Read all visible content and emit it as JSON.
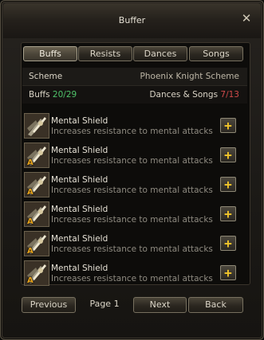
{
  "window": {
    "title": "Buffer",
    "close_icon": "close-icon"
  },
  "tabs": [
    {
      "label": "Buffs",
      "active": true
    },
    {
      "label": "Resists",
      "active": false
    },
    {
      "label": "Dances",
      "active": false
    },
    {
      "label": "Songs",
      "active": false
    }
  ],
  "scheme": {
    "label": "Scheme",
    "value": "Phoenix Knight Scheme"
  },
  "counts": {
    "buffs_label": "Buffs",
    "buffs_value": "20/29",
    "dances_label": "Dances & Songs",
    "dances_value": "7/13"
  },
  "buffs": [
    {
      "name": "Mental Shield",
      "desc": "Increases resistance to mental attacks",
      "badge": ""
    },
    {
      "name": "Mental Shield",
      "desc": "Increases resistance to mental attacks",
      "badge": "A"
    },
    {
      "name": "Mental Shield",
      "desc": "Increases resistance to mental attacks",
      "badge": "A"
    },
    {
      "name": "Mental Shield",
      "desc": "Increases resistance to mental attacks",
      "badge": "A"
    },
    {
      "name": "Mental Shield",
      "desc": "Increases resistance to mental attacks",
      "badge": "A"
    },
    {
      "name": "Mental Shield",
      "desc": "Increases resistance to mental attacks",
      "badge": "A"
    }
  ],
  "add_button_icon": "plus-icon",
  "footer": {
    "previous_label": "Previous",
    "page_label": "Page 1",
    "next_label": "Next",
    "back_label": "Back"
  },
  "colors": {
    "green": "#4fc36a",
    "red": "#d04a4a",
    "plus": "#f2c62a",
    "badge": "#e8a319"
  }
}
